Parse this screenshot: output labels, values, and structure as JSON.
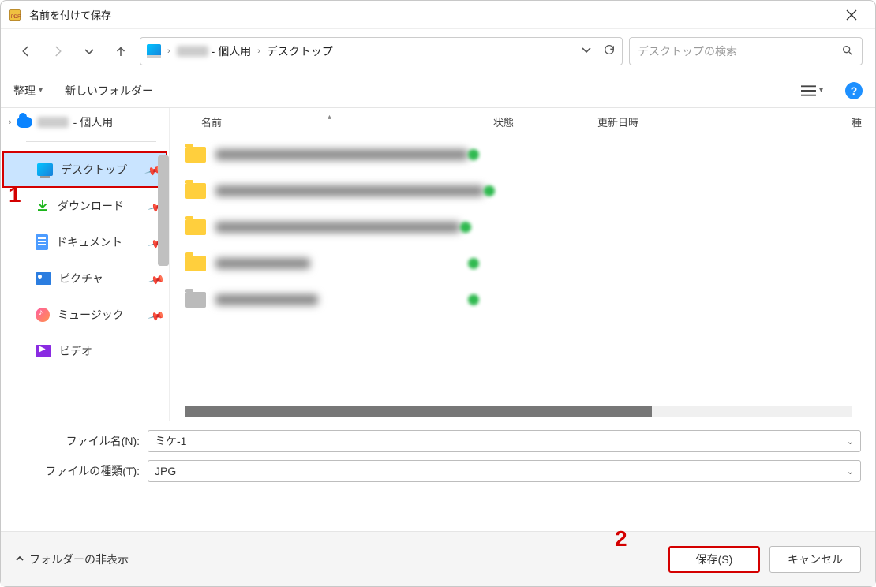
{
  "window": {
    "title": "名前を付けて保存"
  },
  "nav": {
    "path_user": "- 個人用",
    "path_desktop": "デスクトップ"
  },
  "search": {
    "placeholder": "デスクトップの検索"
  },
  "toolbar": {
    "organize": "整理",
    "new_folder": "新しいフォルダー"
  },
  "sidebar": {
    "onedrive_suffix": "- 個人用",
    "items": [
      {
        "label": "デスクトップ"
      },
      {
        "label": "ダウンロード"
      },
      {
        "label": "ドキュメント"
      },
      {
        "label": "ピクチャ"
      },
      {
        "label": "ミュージック"
      },
      {
        "label": "ビデオ"
      }
    ]
  },
  "columns": {
    "name": "名前",
    "status": "状態",
    "date": "更新日時",
    "type": "種"
  },
  "form": {
    "filename_label": "ファイル名(N):",
    "filename_value": "ミケ-1",
    "filetype_label": "ファイルの種類(T):",
    "filetype_value": "JPG"
  },
  "footer": {
    "hide_folders": "フォルダーの非表示",
    "save": "保存(S)",
    "cancel": "キャンセル"
  },
  "annotations": {
    "one": "1",
    "two": "2"
  }
}
